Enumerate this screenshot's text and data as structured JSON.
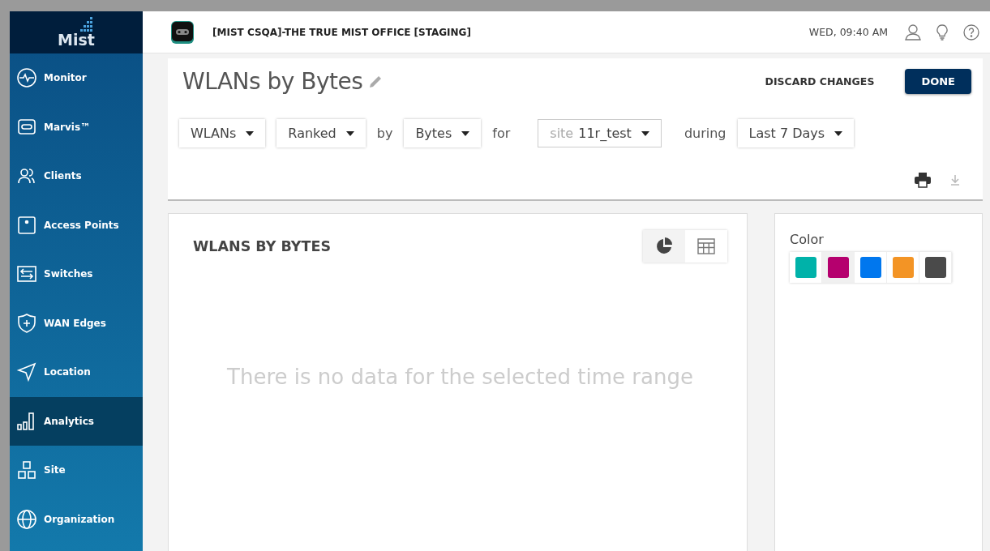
{
  "logo": {
    "text": "Mist"
  },
  "sidebar": {
    "items": [
      {
        "label": "Monitor",
        "selected": false
      },
      {
        "label": "Marvis™",
        "selected": false
      },
      {
        "label": "Clients",
        "selected": false
      },
      {
        "label": "Access Points",
        "selected": false
      },
      {
        "label": "Switches",
        "selected": false
      },
      {
        "label": "WAN Edges",
        "selected": false
      },
      {
        "label": "Location",
        "selected": false
      },
      {
        "label": "Analytics",
        "selected": true
      },
      {
        "label": "Site",
        "selected": false
      },
      {
        "label": "Organization",
        "selected": false
      }
    ]
  },
  "topbar": {
    "org_title": "[MIST CSQA]-THE TRUE MIST OFFICE [STAGING]",
    "datetime": "WED, 09:40 AM"
  },
  "report": {
    "title": "WLANs by Bytes",
    "discard_label": "DISCARD CHANGES",
    "done_label": "DONE",
    "filters": [
      {
        "kind": "dropdown",
        "value": "WLANs"
      },
      {
        "kind": "dropdown",
        "value": "Ranked"
      },
      {
        "kind": "word",
        "text": "by"
      },
      {
        "kind": "dropdown",
        "value": "Bytes"
      },
      {
        "kind": "word",
        "text": "for"
      },
      {
        "kind": "scoped",
        "prefix": "site",
        "value": "11r_test"
      },
      {
        "kind": "word",
        "text": "during"
      },
      {
        "kind": "dropdown",
        "value": "Last 7 Days"
      }
    ]
  },
  "chart_panel": {
    "title": "WLANS BY BYTES",
    "views": [
      {
        "kind": "pie",
        "selected": true
      },
      {
        "kind": "table",
        "selected": false
      }
    ],
    "empty_message": "There is no data for the selected time range"
  },
  "color_panel": {
    "title": "Color",
    "swatches": [
      {
        "color": "#00b2a9",
        "selected": false
      },
      {
        "color": "#b5006e",
        "selected": true
      },
      {
        "color": "#0077ee",
        "selected": false
      },
      {
        "color": "#f39425",
        "selected": false
      },
      {
        "color": "#4a4a4a",
        "selected": false
      }
    ]
  }
}
